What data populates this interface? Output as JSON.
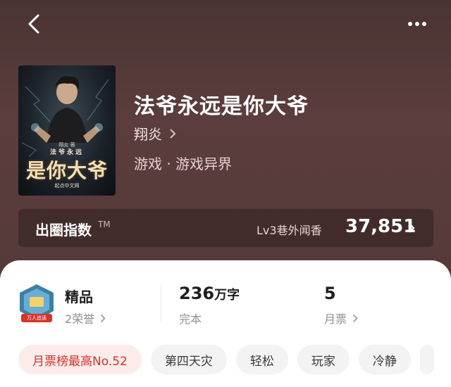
{
  "header": {
    "back_icon": "chevron-left-icon",
    "more_icon": "more-dots-icon"
  },
  "book": {
    "title": "法爷永远是你大爷",
    "author": "翔炎",
    "genre": "游戏 · 游戏异界",
    "cover": {
      "author_line": "翔炎 著",
      "title_small": "法爷永远",
      "title_large": "是你大爷",
      "publisher": "起点中文网"
    }
  },
  "index": {
    "label": "出圈指数",
    "tm": "TM",
    "level": "Lv3巷外闻香",
    "value": "37,851"
  },
  "stats": {
    "badge_text": "万人追读",
    "quality_title": "精品",
    "quality_sub": "2荣誉",
    "words_value": "236",
    "words_unit": "万字",
    "words_sub": "完本",
    "tickets_value": "5",
    "tickets_sub": "月票"
  },
  "tags": [
    "月票榜最高No.52",
    "第四天灾",
    "轻松",
    "玩家",
    "冷静"
  ],
  "colors": {
    "hero_bg": "#563a39",
    "accent": "#d8322b"
  }
}
